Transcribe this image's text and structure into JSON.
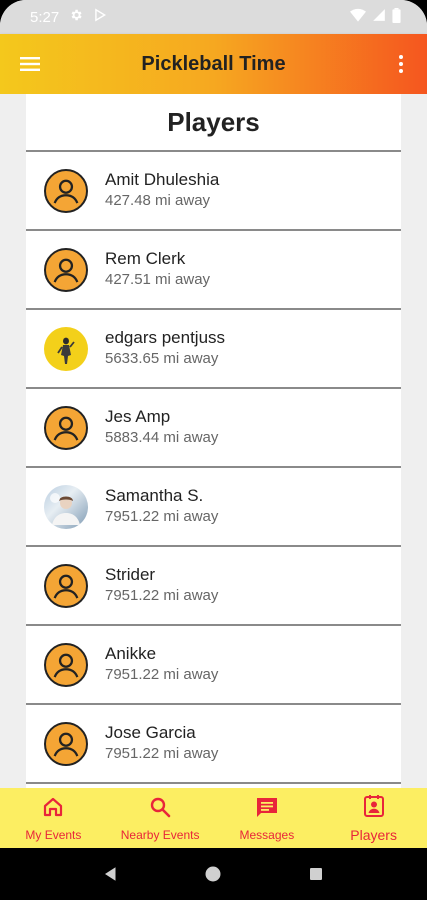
{
  "status_bar": {
    "time": "5:27",
    "icons": [
      "gear-icon",
      "play-store-icon",
      "wifi-icon",
      "signal-icon",
      "battery-icon"
    ]
  },
  "app_bar": {
    "title": "Pickleball Time",
    "gradient": [
      "#f4c81c",
      "#f5561f"
    ],
    "left_icon": "hamburger-menu-icon",
    "right_icon": "more-vert-icon"
  },
  "page": {
    "title": "Players"
  },
  "players": [
    {
      "name": "Amit Dhuleshia",
      "distance": "427.48 mi away",
      "avatar": "default-user-icon"
    },
    {
      "name": "Rem Clerk",
      "distance": "427.51 mi away",
      "avatar": "default-user-icon"
    },
    {
      "name": "edgars pentjuss",
      "distance": "5633.65 mi away",
      "avatar": "photo"
    },
    {
      "name": "Jes Amp",
      "distance": "5883.44 mi away",
      "avatar": "default-user-icon"
    },
    {
      "name": "Samantha S.",
      "distance": "7951.22 mi away",
      "avatar": "photo"
    },
    {
      "name": "Strider",
      "distance": "7951.22 mi away",
      "avatar": "default-user-icon"
    },
    {
      "name": "Anikke",
      "distance": "7951.22 mi away",
      "avatar": "default-user-icon"
    },
    {
      "name": "Jose Garcia",
      "distance": "7951.22 mi away",
      "avatar": "default-user-icon"
    }
  ],
  "bottom_nav": {
    "background": "#fcee62",
    "accent": "#e8253a",
    "items": [
      {
        "label": "My Events",
        "icon": "home-icon",
        "active": false
      },
      {
        "label": "Nearby Events",
        "icon": "search-icon",
        "active": false
      },
      {
        "label": "Messages",
        "icon": "chat-icon",
        "active": false
      },
      {
        "label": "Players",
        "icon": "contact-card-icon",
        "active": true
      }
    ]
  },
  "system_nav": {
    "items": [
      "back-icon",
      "home-circle-icon",
      "recents-icon"
    ]
  }
}
